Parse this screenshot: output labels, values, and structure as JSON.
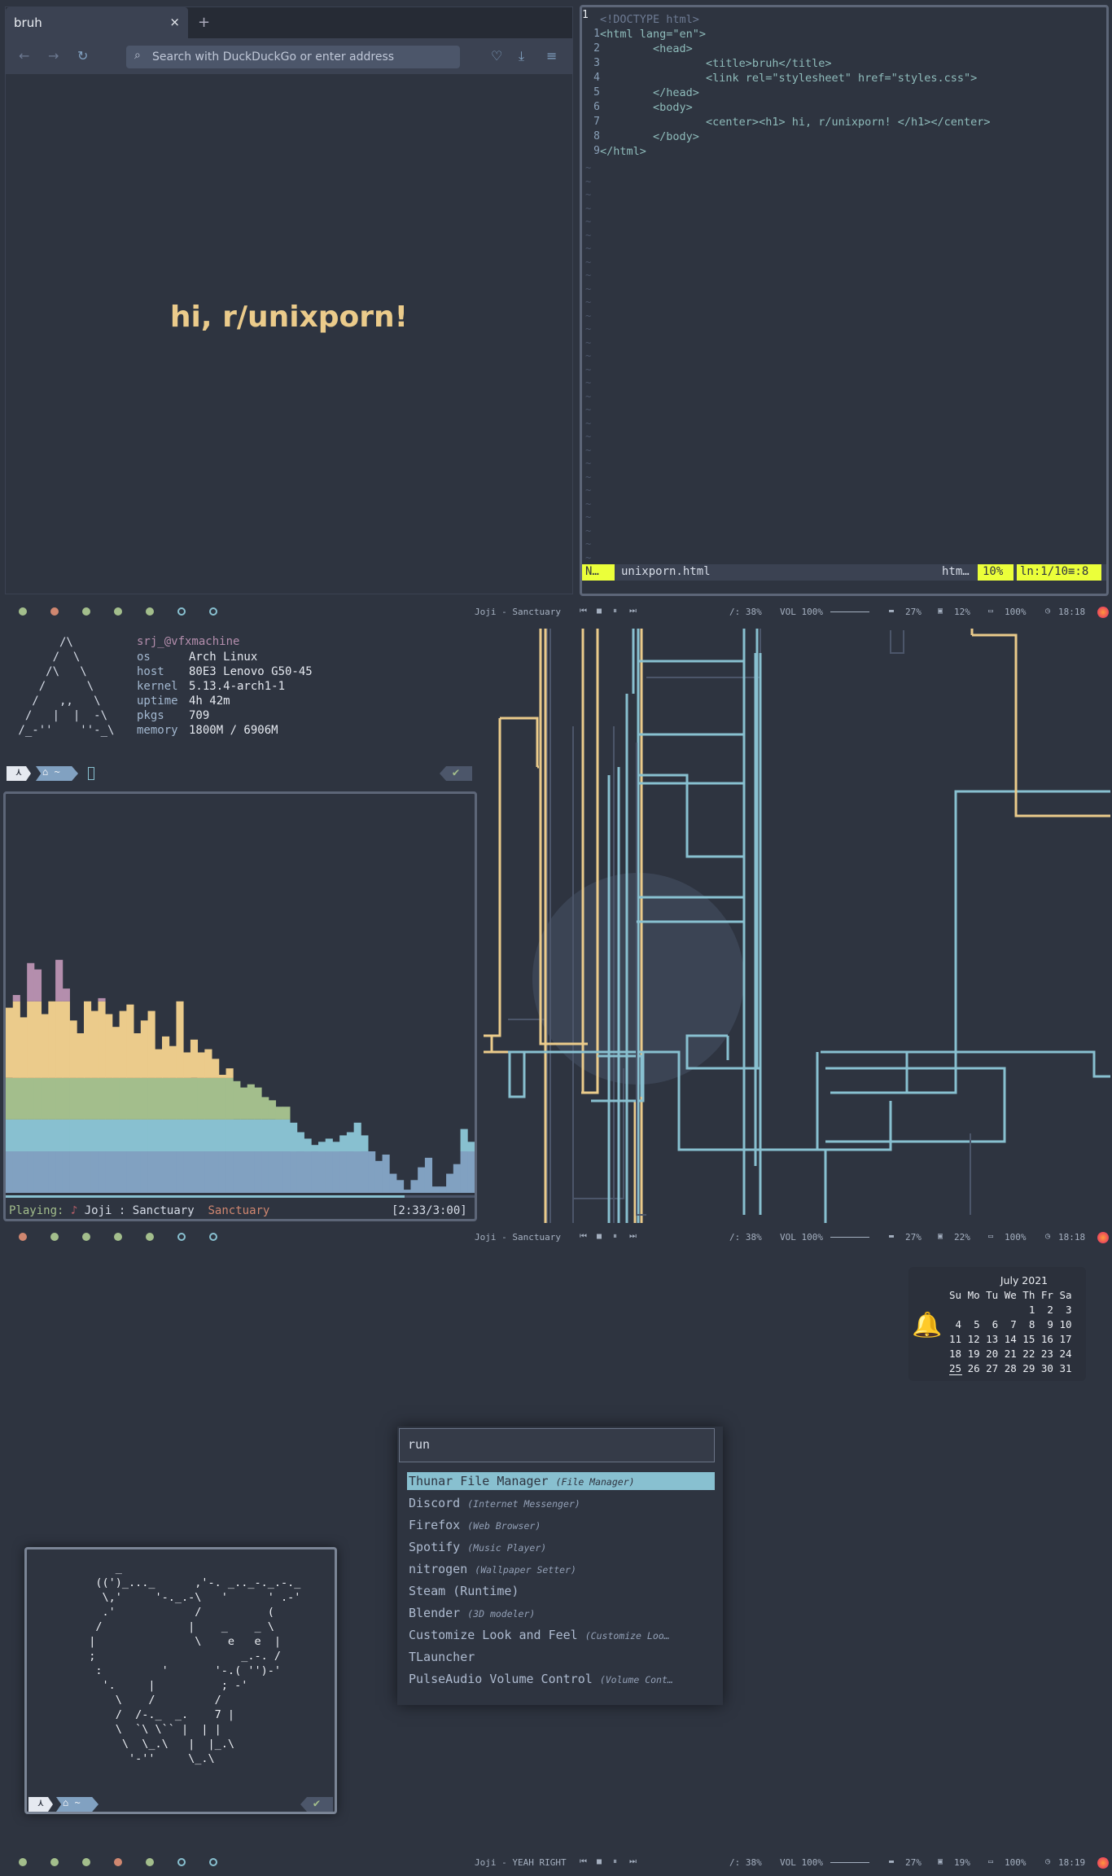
{
  "browser": {
    "tab_title": "bruh",
    "tab_close": "×",
    "new_tab": "+",
    "url_placeholder": "Search with DuckDuckGo or enter address",
    "page_heading": "hi, r/unixporn!"
  },
  "editor": {
    "cursor_line": "1",
    "lines": [
      {
        "num": "",
        "text": "<!DOCTYPE html>"
      },
      {
        "num": "1",
        "text": "<html lang=\"en\">"
      },
      {
        "num": "2",
        "text": "        <head>"
      },
      {
        "num": "3",
        "text": "                <title>bruh</title>"
      },
      {
        "num": "4",
        "text": "                <link rel=\"stylesheet\" href=\"styles.css\">"
      },
      {
        "num": "5",
        "text": "        </head>"
      },
      {
        "num": "6",
        "text": "        <body>"
      },
      {
        "num": "7",
        "text": "                <center><h1> hi, r/unixporn! </h1></center>"
      },
      {
        "num": "8",
        "text": "        </body>"
      },
      {
        "num": "9",
        "text": "</html>"
      }
    ],
    "status": {
      "mode": "N…",
      "file": "unixporn.html",
      "filetype": "htm…",
      "percent": "10%",
      "position": "ln:1/10≡:8"
    }
  },
  "bars": [
    {
      "title": "Joji - Sanctuary",
      "disk": "/: 38%",
      "vol": "VOL 100%",
      "mem": "27%",
      "cpu": "12%",
      "bat": "100%",
      "time": "18:18"
    },
    {
      "title": "Joji - Sanctuary",
      "disk": "/: 38%",
      "vol": "VOL 100%",
      "mem": "27%",
      "cpu": "22%",
      "bat": "100%",
      "time": "18:18"
    },
    {
      "title": "Joji - YEAH RIGHT",
      "disk": "/: 38%",
      "vol": "VOL 100%",
      "mem": "27%",
      "cpu": "19%",
      "bat": "100%",
      "time": "18:19"
    }
  ],
  "neofetch": {
    "user": "srj_@vfxmachine",
    "os_label": "os",
    "os": "Arch Linux",
    "host_label": "host",
    "host": "80E3 Lenovo G50-45",
    "kernel_label": "kernel",
    "kernel": "5.13.4-arch1-1",
    "uptime_label": "uptime",
    "uptime": "4h 42m",
    "pkgs_label": "pkgs",
    "pkgs": "709",
    "memory_label": "memory",
    "memory": "1800M / 6906M",
    "prompt_check": "✔"
  },
  "player": {
    "prefix": "Playing:",
    "artist": "Joji",
    "sep": ":",
    "track": "Sanctuary",
    "album": "Sanctuary",
    "time": "[2:33/3:00]",
    "progress": 0.85
  },
  "calendar": {
    "title": "July 2021",
    "header": "Su Mo Tu We Th Fr Sa",
    "weeks": [
      "             1  2  3",
      " 4  5  6  7  8  9 10",
      "11 12 13 14 15 16 17",
      "18 19 20 21 22 23 24",
      "25 26 27 28 29 30 31"
    ],
    "today": "25"
  },
  "launcher": {
    "query": "run",
    "items": [
      {
        "name": "Thunar File Manager",
        "desc": "(File Manager)"
      },
      {
        "name": "Discord",
        "desc": "(Internet Messenger)"
      },
      {
        "name": "Firefox",
        "desc": "(Web Browser)"
      },
      {
        "name": "Spotify",
        "desc": "(Music Player)"
      },
      {
        "name": "nitrogen",
        "desc": "(Wallpaper Setter)"
      },
      {
        "name": "Steam (Runtime)",
        "desc": ""
      },
      {
        "name": "Blender",
        "desc": "(3D modeler)"
      },
      {
        "name": "Customize Look and Feel",
        "desc": "(Customize Loo…"
      },
      {
        "name": "TLauncher",
        "desc": ""
      },
      {
        "name": "PulseAudio Volume Control",
        "desc": "(Volume Cont…"
      }
    ]
  },
  "colors": {
    "background": "#2e3440",
    "accent_yellow": "#ebcb8b",
    "accent_cyan": "#88c0d0",
    "accent_green": "#a3be8c",
    "accent_red": "#d08770",
    "vim_status": "#ebff3a"
  }
}
